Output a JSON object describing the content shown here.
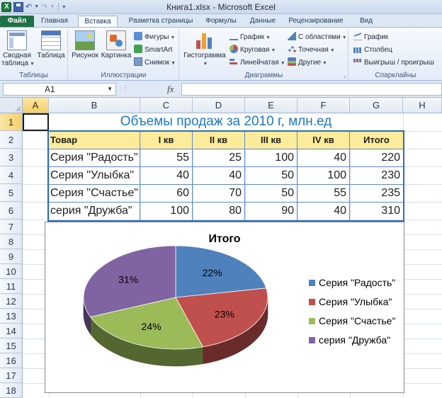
{
  "window": {
    "title": "Книга1.xlsx - Microsoft Excel"
  },
  "tabs": [
    {
      "label": "Файл"
    },
    {
      "label": "Главная"
    },
    {
      "label": "Вставка"
    },
    {
      "label": "Разметка страницы"
    },
    {
      "label": "Формулы"
    },
    {
      "label": "Данные"
    },
    {
      "label": "Рецензирование"
    },
    {
      "label": "Вид"
    }
  ],
  "ribbon": {
    "tables": {
      "group_label": "Таблицы",
      "pivot_label_1": "Сводная",
      "pivot_label_2": "таблица",
      "table_label": "Таблица"
    },
    "illustrations": {
      "group_label": "Иллюстрации",
      "picture_label": "Рисунок",
      "clipart_label": "Картинка",
      "shapes_label": "Фигуры",
      "smartart_label": "SmartArt",
      "screenshot_label": "Снимок"
    },
    "charts": {
      "group_label": "Диаграммы",
      "histogram_label": "Гистограмма",
      "line_label": "График",
      "pie_label": "Круговая",
      "bar_label": "Линейчатая",
      "area_label": "С областями",
      "scatter_label": "Точечная",
      "other_label": "Другие"
    },
    "sparklines": {
      "group_label": "Спарклайны",
      "line_label": "График",
      "column_label": "Столбец",
      "winloss_label": "Выигрыш / проигрыш"
    }
  },
  "formula_bar": {
    "name_box": "A1",
    "fx": "fx",
    "content": ""
  },
  "columns": [
    "A",
    "B",
    "C",
    "D",
    "E",
    "F",
    "G",
    "H"
  ],
  "rows": [
    "1",
    "2",
    "3",
    "4",
    "5",
    "6",
    "7",
    "8",
    "9",
    "10",
    "11",
    "12",
    "13",
    "14",
    "15",
    "16",
    "17",
    "18"
  ],
  "sheet": {
    "title": "Объемы продаж за 2010 г, млн.ед",
    "headers": [
      "Товар",
      "I кв",
      "II кв",
      "III кв",
      "IV кв",
      "Итого"
    ],
    "rows": [
      [
        "Серия \"Радость\"",
        "55",
        "25",
        "100",
        "40",
        "220"
      ],
      [
        "Серия \"Улыбка\"",
        "40",
        "40",
        "50",
        "100",
        "230"
      ],
      [
        "Серия \"Счастье\"",
        "60",
        "70",
        "50",
        "55",
        "235"
      ],
      [
        "серия \"Дружба\"",
        "100",
        "80",
        "90",
        "40",
        "310"
      ]
    ]
  },
  "chart_data": {
    "type": "pie",
    "title": "Итого",
    "categories": [
      "Серия \"Радость\"",
      "Серия \"Улыбка\"",
      "Серия \"Счастье\"",
      "серия \"Дружба\""
    ],
    "values": [
      220,
      230,
      235,
      310
    ],
    "data_labels": [
      "22%",
      "23%",
      "24%",
      "31%"
    ],
    "colors": [
      "#4f81bd",
      "#c0504d",
      "#9bbb59",
      "#8064a2"
    ],
    "legend": "right",
    "style": "3d"
  }
}
